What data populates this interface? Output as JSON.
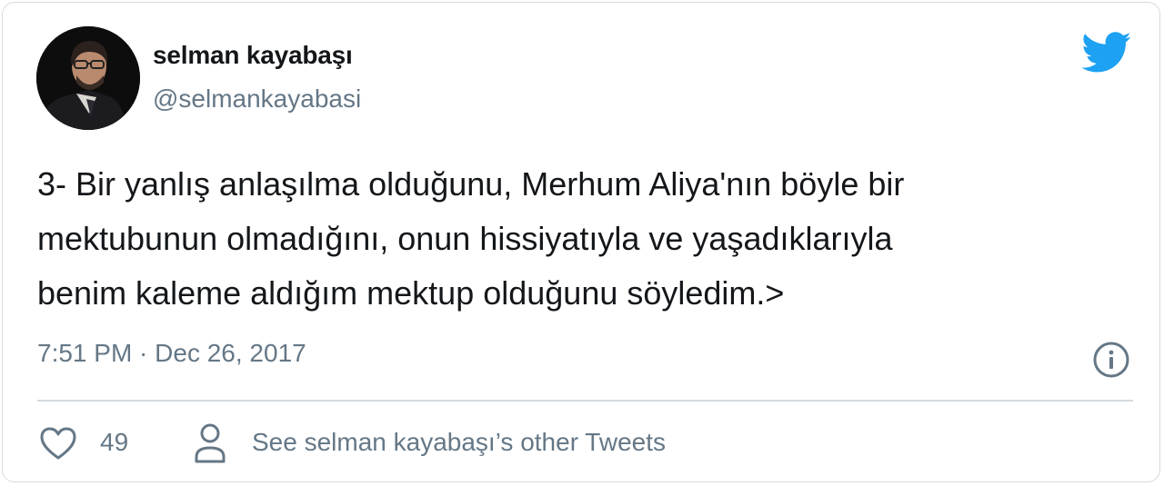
{
  "author": {
    "name": "selman kayabaşı",
    "handle": "@selmankayabasi",
    "avatar_icon": "profile-photo"
  },
  "tweet": {
    "lines": [
      "3- Bir yanlış anlaşılma olduğunu, Merhum Aliya'nın böyle bir",
      "mektubunun olmadığını, onun hissiyatıyla ve yaşadıklarıyla",
      "benim kaleme aldığım mektup olduğunu söyledim.>"
    ],
    "timestamp": "7:51 PM · Dec 26, 2017"
  },
  "actions": {
    "like_icon": "heart-outline",
    "like_count": "49",
    "profile_icon": "person-outline",
    "other_tweets_label": "See selman kayabaşı’s other Tweets",
    "info_icon": "info-circle"
  },
  "brand": {
    "icon": "twitter-bird",
    "color": "#1da1f2"
  },
  "colors": {
    "text": "#14171a",
    "secondary": "#657786",
    "border": "#d4dbe1"
  }
}
